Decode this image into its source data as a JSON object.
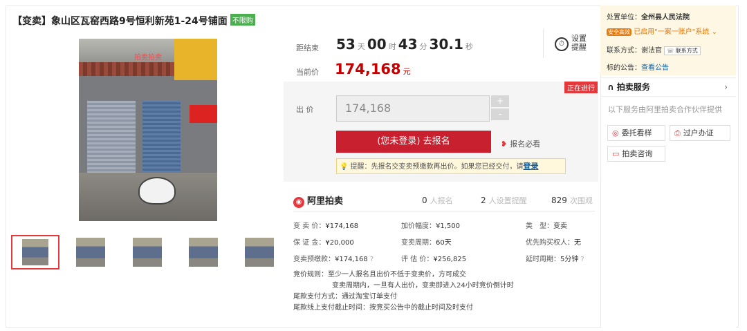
{
  "listing": {
    "title": "【变卖】象山区瓦窑西路9号恒利新苑1-24号铺面",
    "limit_tag": "不限购",
    "watermark": "拍卖拍卖"
  },
  "timer": {
    "label": "距结束",
    "days": "53",
    "days_unit": "天",
    "hours": "00",
    "hours_unit": "时",
    "minutes": "43",
    "minutes_unit": "分",
    "seconds": "30.1",
    "seconds_unit": "秒",
    "reminder_label": "设置提醒"
  },
  "price": {
    "label": "当前价",
    "value": "174,168",
    "unit": "元"
  },
  "bid": {
    "status_badge": "正在进行",
    "label": "出 价",
    "value": "174,168",
    "plus": "+",
    "minus": "-",
    "signup_button": "(您未登录) 去报名",
    "must_read": "报名必看",
    "tip_text": "提醒：先报名交变卖预缴款再出价。如果您已经交付，请",
    "tip_link": "登录"
  },
  "platform": {
    "name": "阿里拍卖",
    "signed_count": "0",
    "signed_label": "人报名",
    "remind_count": "2",
    "remind_label": "人设置提醒",
    "views_count": "829",
    "views_label": "次围观"
  },
  "details": {
    "row1": [
      {
        "k": "变 卖 价：",
        "v": "¥174,168"
      },
      {
        "k": "加价幅度：",
        "v": "¥1,500"
      },
      {
        "k": "类　型：",
        "v": "变卖"
      }
    ],
    "row2": [
      {
        "k": "保 证 金：",
        "v": "¥20,000"
      },
      {
        "k": "变卖周期：",
        "v": "60天"
      },
      {
        "k": "优先购买权人",
        "v": "：无"
      }
    ],
    "row3": [
      {
        "k": "变卖预缴款：",
        "v": "¥174,168"
      },
      {
        "k": "评 估 价：",
        "v": "¥256,825"
      },
      {
        "k": "延时周期：",
        "v": "5分钟"
      }
    ]
  },
  "rules": {
    "line1": "竞价规则：至少一人报名且出价不低于变卖价，方可成交",
    "line2": "变卖周期内，一旦有人出价，变卖即进入24小时竞价倒计时",
    "line3": "尾款支付方式：通过淘宝订单支付",
    "line4": "尾款线上支付截止时间：按竞买公告中的截止时间及时支付"
  },
  "court": {
    "unit_label": "处置单位：",
    "unit_value": "全州县人民法院",
    "chip": "安全高效",
    "system_text": "已启用\"一案一账户\"系统",
    "contact_label": "联系方式：",
    "contact_name": "谢法官",
    "contact_button": "联系方式",
    "notice_label": "标的公告：",
    "notice_link": "查看公告"
  },
  "service": {
    "title": "拍卖服务",
    "note": "以下服务由阿里拍卖合作伙伴提供",
    "btn_view": "委托看样",
    "btn_transfer": "过户办证",
    "btn_consult": "拍卖咨询"
  }
}
